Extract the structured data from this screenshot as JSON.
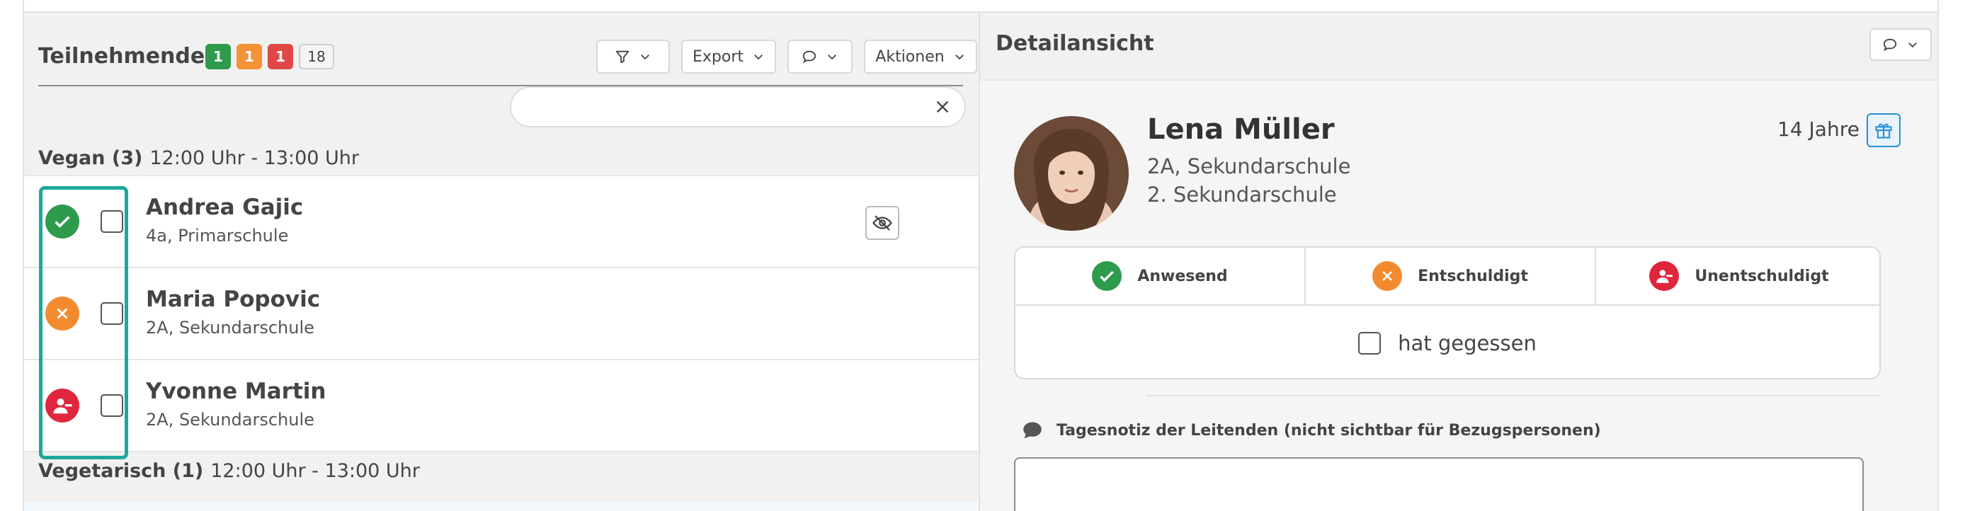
{
  "participants": {
    "title": "Teilnehmende",
    "counts": {
      "present": "1",
      "excused": "1",
      "unexcused": "1",
      "total": "18"
    },
    "toolbar": {
      "export_label": "Export",
      "actions_label": "Aktionen"
    },
    "search": {
      "value": "",
      "placeholder": ""
    },
    "groups": [
      {
        "name": "Vegan (3)",
        "time": "12:00 Uhr - 13:00 Uhr",
        "rows": [
          {
            "name": "Andrea Gajic",
            "class": "4a, Primarschule",
            "status": "present"
          },
          {
            "name": "Maria Popovic",
            "class": "2A, Sekundarschule",
            "status": "excused"
          },
          {
            "name": "Yvonne Martin",
            "class": "2A, Sekundarschule",
            "status": "unexcused"
          }
        ]
      },
      {
        "name": "Vegetarisch (1)",
        "time": "12:00 Uhr - 13:00 Uhr",
        "rows": []
      }
    ]
  },
  "detail": {
    "title": "Detailansicht",
    "person": {
      "name": "Lena Müller",
      "line1": "2A, Sekundarschule",
      "line2": "2. Sekundarschule",
      "age": "14 Jahre"
    },
    "attendance": {
      "present_label": "Anwesend",
      "excused_label": "Entschuldigt",
      "unexcused_label": "Unentschuldigt",
      "ate_label": "hat gegessen"
    },
    "note_label": "Tagesnotiz der Leitenden (nicht sichtbar für Bezugspersonen)",
    "note_value": ""
  },
  "colors": {
    "present": "#2e9a4c",
    "excused": "#f38a2f",
    "unexcused": "#e0263d",
    "highlight": "#1ea89b",
    "gift_accent": "#2a8fd6"
  },
  "icons": [
    "filter-icon",
    "comment-icon",
    "chevron-down-icon",
    "close-icon",
    "check-icon",
    "x-icon",
    "user-minus-icon",
    "eye-off-icon",
    "gift-icon"
  ]
}
